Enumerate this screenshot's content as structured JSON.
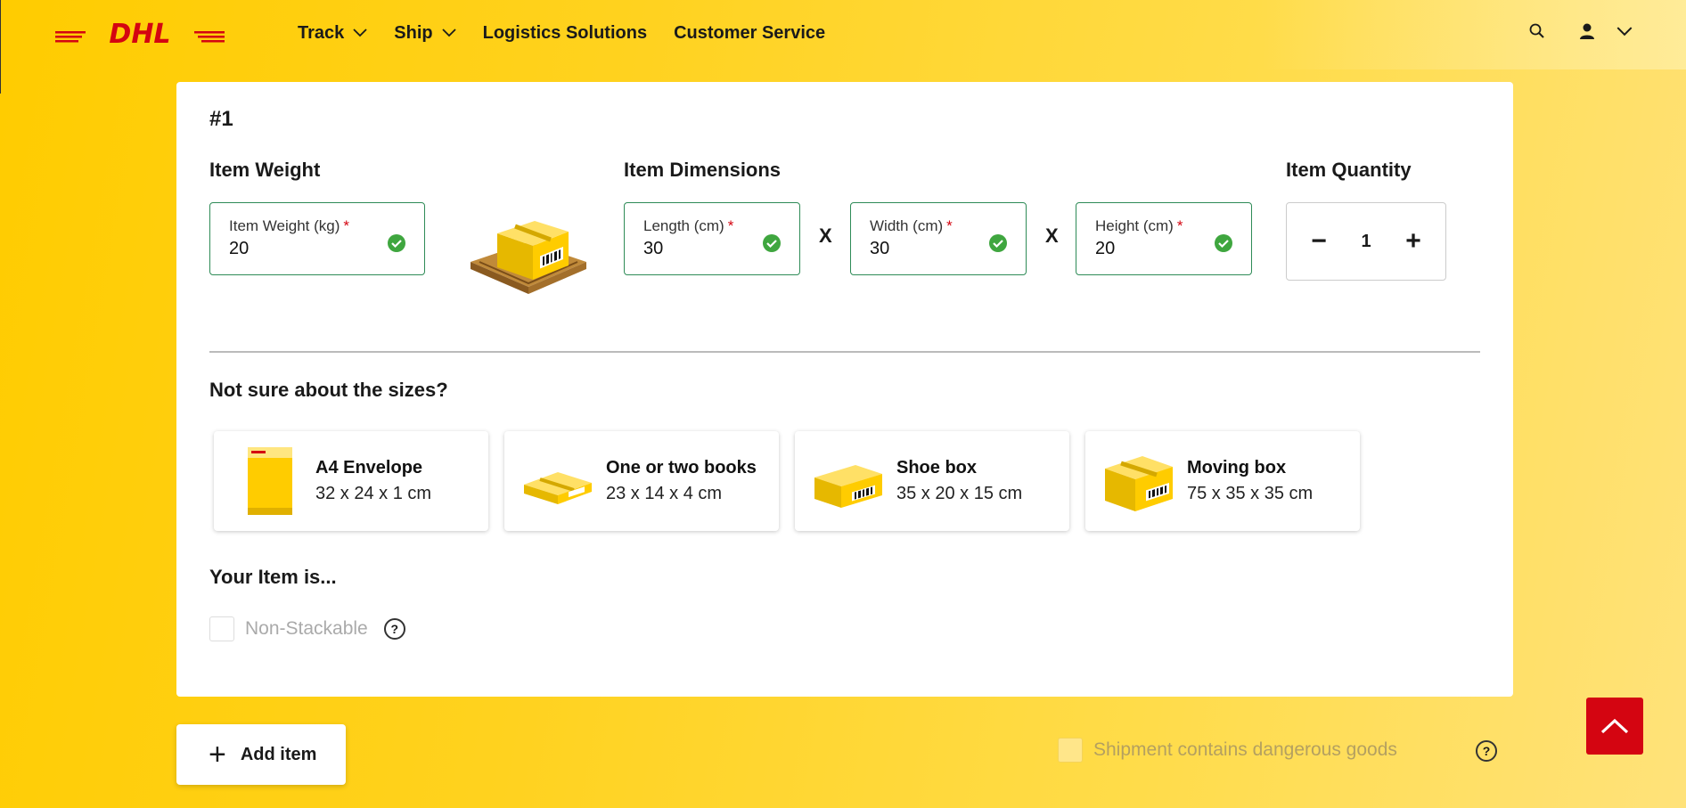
{
  "brand": {
    "logo_text": "DHL",
    "logo_color": "#d40511",
    "accent": "#ffcc00"
  },
  "nav": {
    "items": [
      {
        "label": "Track",
        "has_dropdown": true
      },
      {
        "label": "Ship",
        "has_dropdown": true
      },
      {
        "label": "Logistics Solutions",
        "has_dropdown": false
      },
      {
        "label": "Customer Service",
        "has_dropdown": false
      }
    ],
    "icons": [
      "search-icon",
      "user-icon",
      "chevron-down-icon"
    ]
  },
  "item": {
    "number": "#1",
    "weight": {
      "section": "Item Weight",
      "label": "Item Weight (kg)",
      "required": "*",
      "value": "20"
    },
    "dimensions": {
      "section": "Item Dimensions",
      "separator": "X",
      "length": {
        "label": "Length (cm)",
        "required": "*",
        "value": "30"
      },
      "width": {
        "label": "Width (cm)",
        "required": "*",
        "value": "30"
      },
      "height": {
        "label": "Height (cm)",
        "required": "*",
        "value": "20"
      }
    },
    "quantity": {
      "section": "Item Quantity",
      "minus": "−",
      "value": "1",
      "plus": "+"
    }
  },
  "presets": {
    "heading": "Not sure about the sizes?",
    "items": [
      {
        "title": "A4 Envelope",
        "size": "32 x 24 x 1 cm",
        "icon": "envelope-icon"
      },
      {
        "title": "One or two books",
        "size": "23 x 14 x 4 cm",
        "icon": "flat-box-icon"
      },
      {
        "title": "Shoe box",
        "size": "35 x 20 x 15 cm",
        "icon": "shoe-box-icon"
      },
      {
        "title": "Moving box",
        "size": "75 x 35 x 35 cm",
        "icon": "moving-box-icon"
      }
    ]
  },
  "attributes": {
    "heading": "Your Item is...",
    "non_stackable": {
      "label": "Non-Stackable",
      "checked": false,
      "help": "?"
    }
  },
  "actions": {
    "add_item": {
      "plus": "+",
      "label": "Add item"
    },
    "dangerous_goods": {
      "label": "Shipment contains dangerous goods",
      "checked": false,
      "help": "?"
    },
    "back_to_top": "chevron-up-icon"
  }
}
